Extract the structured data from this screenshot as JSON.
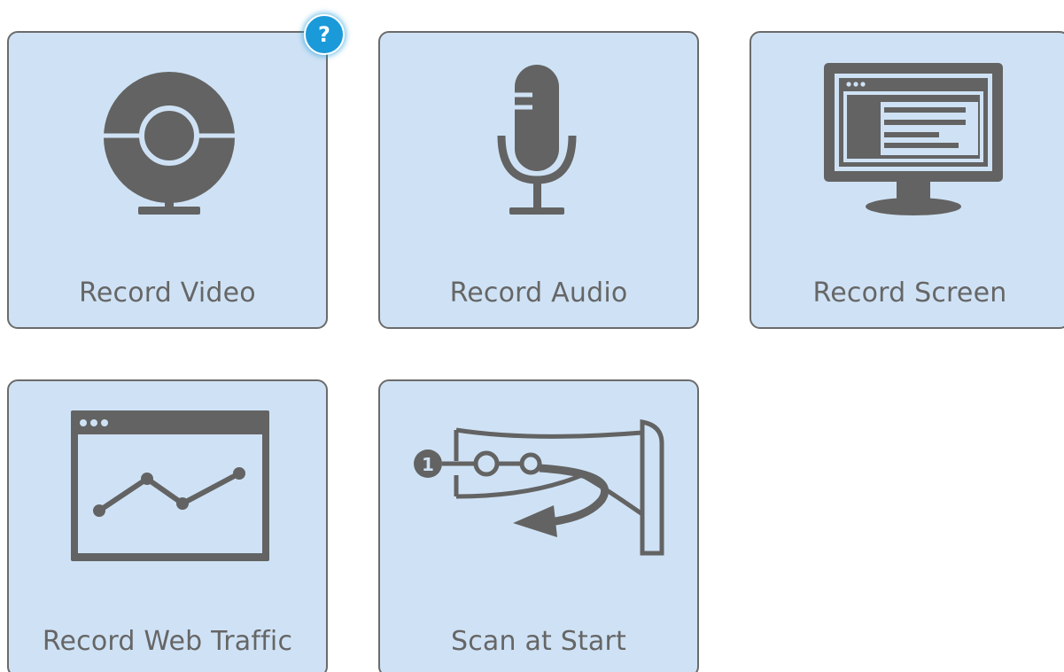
{
  "help": {
    "label": "?",
    "color": "#1a9ad9"
  },
  "tiles": [
    {
      "label": "Record Video",
      "icon": "webcam-icon"
    },
    {
      "label": "Record Audio",
      "icon": "microphone-icon"
    },
    {
      "label": "Record Screen",
      "icon": "monitor-icon"
    },
    {
      "label": "Record Web Traffic",
      "icon": "browser-chart-icon"
    },
    {
      "label": "Scan at Start",
      "icon": "scan-flow-icon"
    }
  ],
  "colors": {
    "tile_bg": "#cfe2f5",
    "tile_border": "#6b6b6b",
    "icon": "#636363",
    "label_text": "#666666"
  }
}
